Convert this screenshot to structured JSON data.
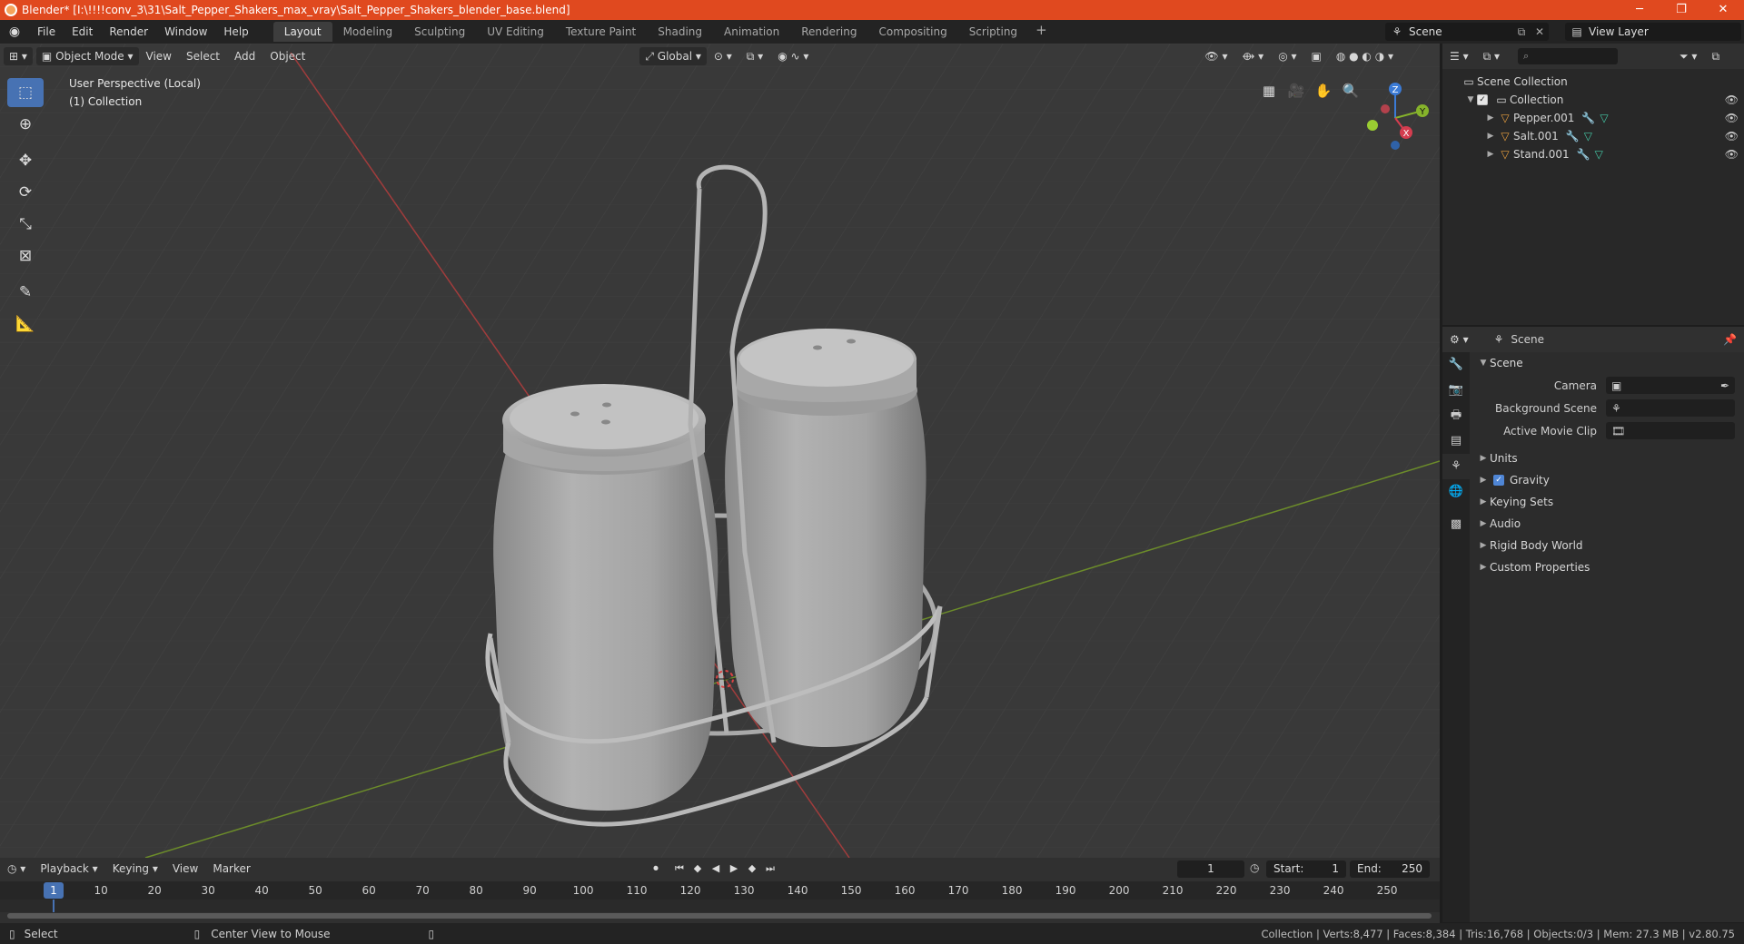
{
  "window": {
    "title": "Blender* [I:\\!!!!conv_3\\31\\Salt_Pepper_Shakers_max_vray\\Salt_Pepper_Shakers_blender_base.blend]",
    "minimize": "─",
    "maximize": "❐",
    "close": "✕"
  },
  "menu": [
    "File",
    "Edit",
    "Render",
    "Window",
    "Help"
  ],
  "workspaces": [
    "Layout",
    "Modeling",
    "Sculpting",
    "UV Editing",
    "Texture Paint",
    "Shading",
    "Animation",
    "Rendering",
    "Compositing",
    "Scripting"
  ],
  "active_workspace": "Layout",
  "add_workspace": "+",
  "scene_name": "Scene",
  "view_layer": "View Layer",
  "viewport": {
    "mode": "Object Mode",
    "menus": [
      "View",
      "Select",
      "Add",
      "Object"
    ],
    "orientation": "Global",
    "info_line1": "User Perspective (Local)",
    "info_line2": "(1) Collection",
    "gizmo": {
      "x": "X",
      "y": "Y",
      "z": "Z"
    }
  },
  "outliner": {
    "search_placeholder": "⌕",
    "root": "Scene Collection",
    "collection": "Collection",
    "objects": [
      "Pepper.001",
      "Salt.001",
      "Stand.001"
    ]
  },
  "properties": {
    "header": "Scene",
    "section": "Scene",
    "fields": [
      {
        "label": "Camera",
        "value": ""
      },
      {
        "label": "Background Scene",
        "value": ""
      },
      {
        "label": "Active Movie Clip",
        "value": ""
      }
    ],
    "subsections": [
      "Units",
      "Gravity",
      "Keying Sets",
      "Audio",
      "Rigid Body World",
      "Custom Properties"
    ]
  },
  "timeline": {
    "menus": [
      "Playback",
      "Keying",
      "View",
      "Marker"
    ],
    "current_frame": "1",
    "start_label": "Start:",
    "start": "1",
    "end_label": "End:",
    "end": "250",
    "ticks": [
      "10",
      "20",
      "30",
      "40",
      "50",
      "60",
      "70",
      "80",
      "90",
      "100",
      "110",
      "120",
      "130",
      "140",
      "150",
      "160",
      "170",
      "180",
      "190",
      "200",
      "210",
      "220",
      "230",
      "240",
      "250"
    ],
    "cursor_frame": "1"
  },
  "statusbar": {
    "left": "Select",
    "middle": "Center View to Mouse",
    "right": "Collection | Verts:8,477 | Faces:8,384 | Tris:16,768 | Objects:0/3 | Mem: 27.3 MB | v2.80.75"
  }
}
